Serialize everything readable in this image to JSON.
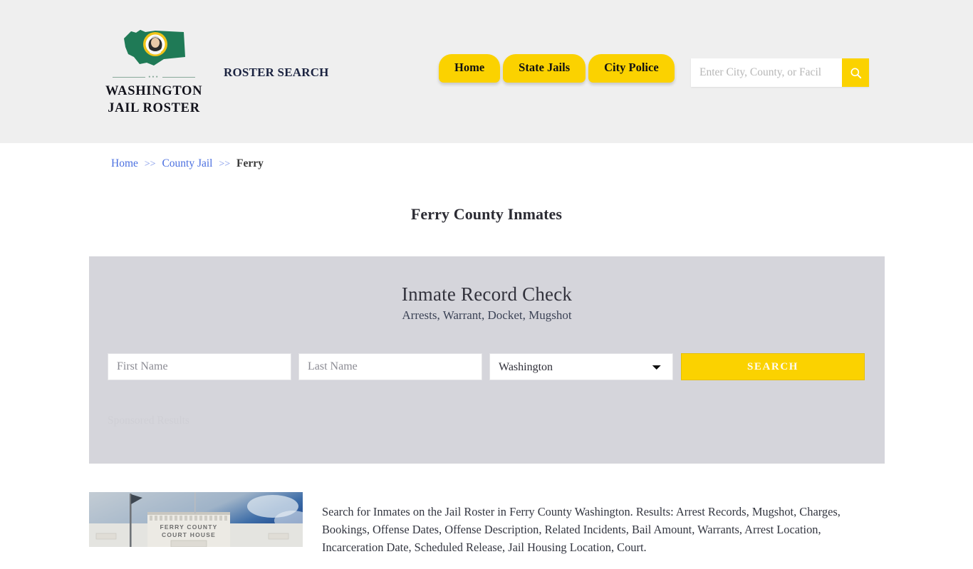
{
  "header": {
    "brand": {
      "line1": "WASHINGTON",
      "line2": "JAIL ROSTER",
      "flag_icon": "washington-state-flag-icon",
      "flag_color": "#1f7a56",
      "seal_color": "#f0c419"
    },
    "tagline": "ROSTER SEARCH",
    "nav": [
      {
        "label": "Home"
      },
      {
        "label": "State Jails"
      },
      {
        "label": "City Police"
      }
    ],
    "search": {
      "placeholder": "Enter City, County, or Facil",
      "value": "",
      "button_icon": "search-icon"
    },
    "background": "#efefef",
    "accent": "#fbd200"
  },
  "breadcrumb": {
    "items": [
      {
        "label": "Home",
        "link": true
      },
      {
        "label": "County Jail",
        "link": true
      },
      {
        "label": "Ferry",
        "link": false
      }
    ],
    "separator": ">>"
  },
  "page": {
    "title": "Ferry County Inmates"
  },
  "record_check": {
    "title": "Inmate Record Check",
    "subtitle": "Arrests, Warrant, Docket, Mugshot",
    "first_name": {
      "placeholder": "First Name",
      "value": ""
    },
    "last_name": {
      "placeholder": "Last Name",
      "value": ""
    },
    "state": {
      "selected": "Washington",
      "options": [
        "Washington"
      ]
    },
    "search_button": "SEARCH",
    "sponsored_label": "Sponsored Results",
    "panel_color": "#d5d5db"
  },
  "content": {
    "photo_alt": "FERRY COUNTY COURT HOUSE",
    "photo_sign_line1": "FERRY COUNTY",
    "photo_sign_line2": "COURT HOUSE",
    "description": "Search for Inmates on the Jail Roster in Ferry County Washington. Results: Arrest Records, Mugshot, Charges, Bookings, Offense Dates, Offense Description, Related Incidents, Bail Amount, Warrants, Arrest Location, Incarceration Date, Scheduled Release, Jail Housing Location, Court."
  }
}
